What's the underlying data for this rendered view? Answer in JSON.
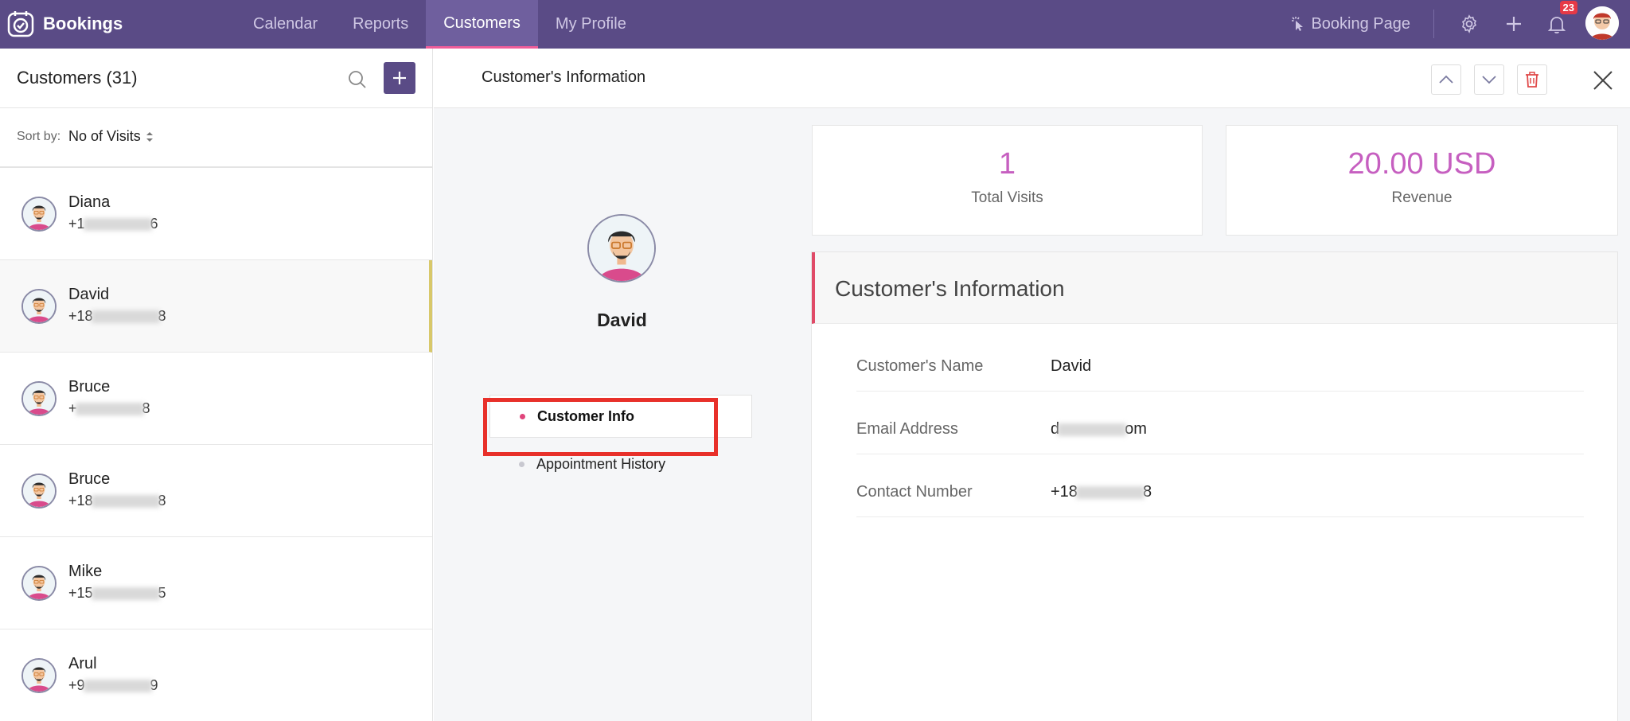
{
  "app": {
    "name": "Bookings",
    "nav": [
      "Calendar",
      "Reports",
      "Customers",
      "My Profile"
    ],
    "active_nav": "Customers",
    "booking_page_label": "Booking Page",
    "notification_count": "23"
  },
  "left": {
    "title": "Customers (31)",
    "sort_label": "Sort by:",
    "sort_value": "No of Visits",
    "customers": [
      {
        "name": "Diana",
        "phone_prefix": "+1",
        "phone_suffix": "6"
      },
      {
        "name": "David",
        "phone_prefix": "+18",
        "phone_suffix": "8"
      },
      {
        "name": "Bruce",
        "phone_prefix": "+",
        "phone_suffix": "8"
      },
      {
        "name": "Bruce",
        "phone_prefix": "+18",
        "phone_suffix": "8"
      },
      {
        "name": "Mike",
        "phone_prefix": "+15",
        "phone_suffix": "5"
      },
      {
        "name": "Arul",
        "phone_prefix": "+9",
        "phone_suffix": "9"
      }
    ],
    "selected_index": 1
  },
  "detail": {
    "header_title": "Customer's Information",
    "customer_name": "David",
    "menu": [
      "Customer Info",
      "Appointment History"
    ],
    "active_menu": "Customer Info",
    "stats": {
      "total_visits_value": "1",
      "total_visits_label": "Total Visits",
      "revenue_value": "20.00 USD",
      "revenue_label": "Revenue"
    },
    "info_title": "Customer's Information",
    "fields": [
      {
        "label": "Customer's Name",
        "value_prefix": "David",
        "value_suffix": ""
      },
      {
        "label": "Email Address",
        "value_prefix": "d",
        "value_suffix": "om"
      },
      {
        "label": "Contact Number",
        "value_prefix": "+18",
        "value_suffix": "8"
      }
    ]
  },
  "colors": {
    "topbar": "#5a4b86",
    "accent_pink": "#e0457b",
    "stat_value": "#c65fc0",
    "highlight": "#e8302a"
  }
}
